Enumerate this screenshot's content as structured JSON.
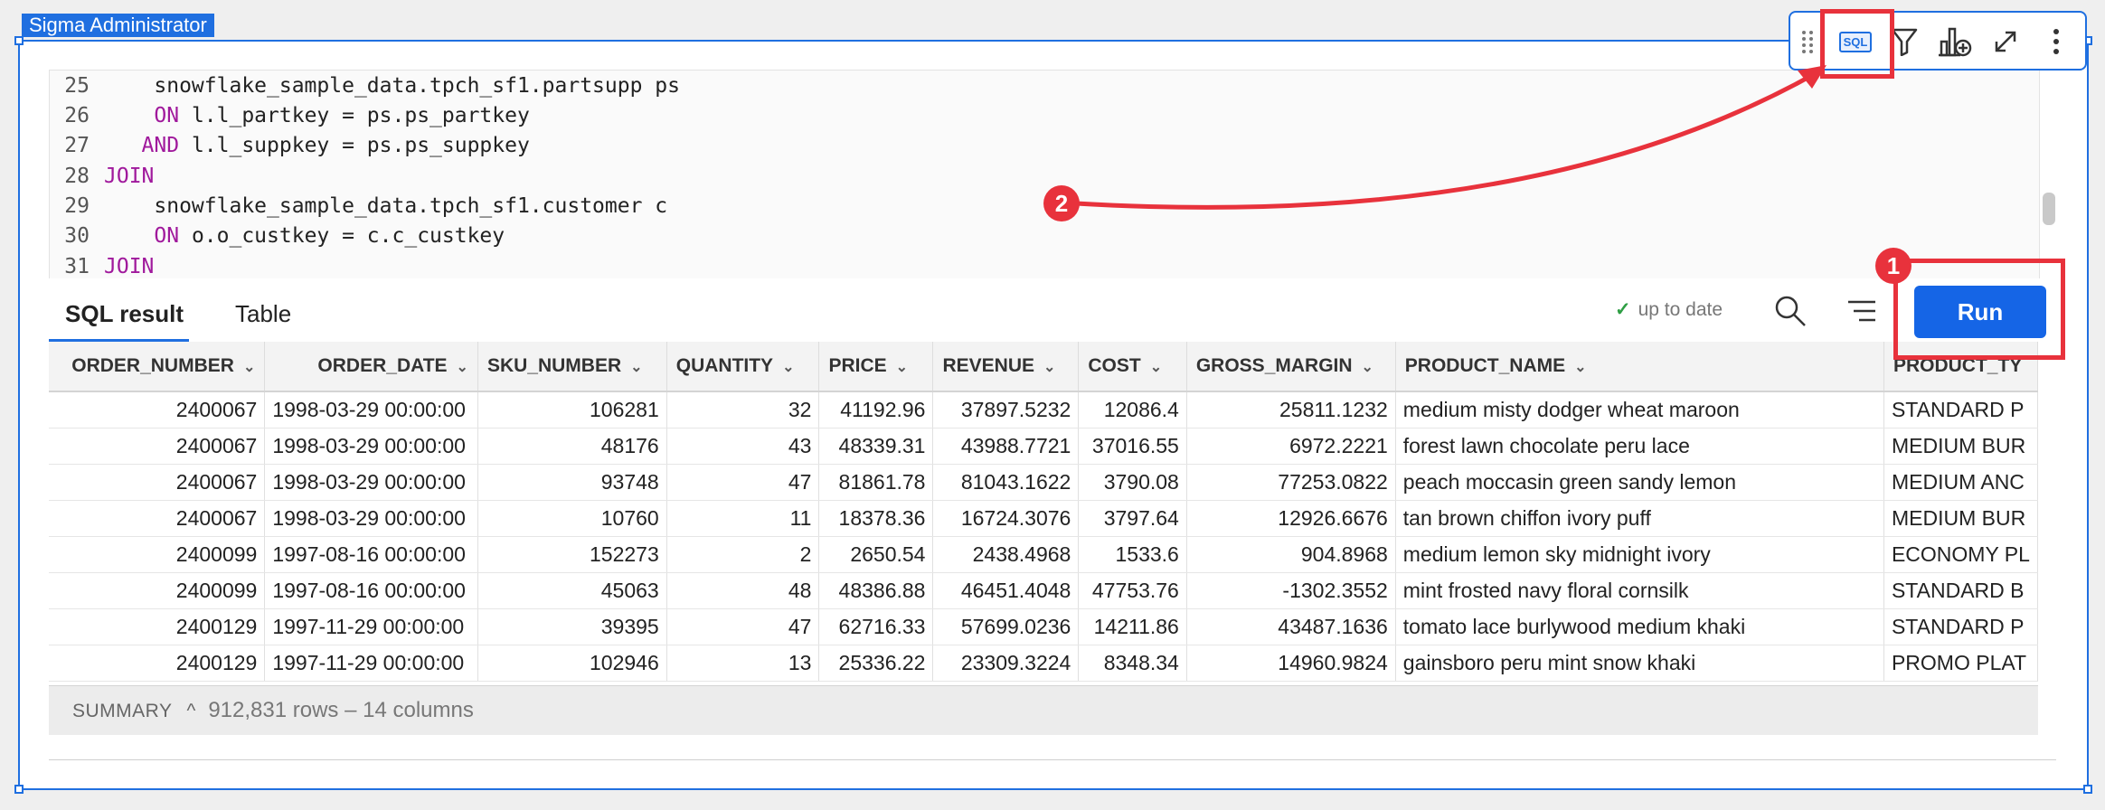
{
  "owner_tag": "Sigma Administrator",
  "code_lines": [
    {
      "num": "25",
      "indent": "    ",
      "kw": "",
      "rest": "snowflake_sample_data.tpch_sf1.partsupp ps"
    },
    {
      "num": "26",
      "indent": "    ",
      "kw": "ON",
      "rest": " l.l_partkey = ps.ps_partkey"
    },
    {
      "num": "27",
      "indent": "   ",
      "kw": "AND",
      "rest": " l.l_suppkey = ps.ps_suppkey"
    },
    {
      "num": "28",
      "indent": "",
      "kw": "JOIN",
      "rest": ""
    },
    {
      "num": "29",
      "indent": "    ",
      "kw": "",
      "rest": "snowflake_sample_data.tpch_sf1.customer c"
    },
    {
      "num": "30",
      "indent": "    ",
      "kw": "ON",
      "rest": " o.o_custkey = c.c_custkey"
    },
    {
      "num": "31",
      "indent": "",
      "kw": "JOIN",
      "rest": ""
    }
  ],
  "toolbar": {
    "sql_label": "SQL"
  },
  "callouts": {
    "one": "1",
    "two": "2"
  },
  "tabs": {
    "sql_result": "SQL result",
    "table": "Table"
  },
  "status": {
    "text": "up to date"
  },
  "run_label": "Run",
  "columns": [
    "ORDER_NUMBER",
    "ORDER_DATE",
    "SKU_NUMBER",
    "QUANTITY",
    "PRICE",
    "REVENUE",
    "COST",
    "GROSS_MARGIN",
    "PRODUCT_NAME",
    "PRODUCT_TY"
  ],
  "rows": [
    [
      "2400067",
      "1998-03-29 00:00:00",
      "106281",
      "32",
      "41192.96",
      "37897.5232",
      "12086.4",
      "25811.1232",
      "medium misty dodger wheat maroon",
      "STANDARD P"
    ],
    [
      "2400067",
      "1998-03-29 00:00:00",
      "48176",
      "43",
      "48339.31",
      "43988.7721",
      "37016.55",
      "6972.2221",
      "forest lawn chocolate peru lace",
      "MEDIUM BUR"
    ],
    [
      "2400067",
      "1998-03-29 00:00:00",
      "93748",
      "47",
      "81861.78",
      "81043.1622",
      "3790.08",
      "77253.0822",
      "peach moccasin green sandy lemon",
      "MEDIUM ANC"
    ],
    [
      "2400067",
      "1998-03-29 00:00:00",
      "10760",
      "11",
      "18378.36",
      "16724.3076",
      "3797.64",
      "12926.6676",
      "tan brown chiffon ivory puff",
      "MEDIUM BUR"
    ],
    [
      "2400099",
      "1997-08-16 00:00:00",
      "152273",
      "2",
      "2650.54",
      "2438.4968",
      "1533.6",
      "904.8968",
      "medium lemon sky midnight ivory",
      "ECONOMY PL"
    ],
    [
      "2400099",
      "1997-08-16 00:00:00",
      "45063",
      "48",
      "48386.88",
      "46451.4048",
      "47753.76",
      "-1302.3552",
      "mint frosted navy floral cornsilk",
      "STANDARD B"
    ],
    [
      "2400129",
      "1997-11-29 00:00:00",
      "39395",
      "47",
      "62716.33",
      "57699.0236",
      "14211.86",
      "43487.1636",
      "tomato lace burlywood medium khaki",
      "STANDARD P"
    ],
    [
      "2400129",
      "1997-11-29 00:00:00",
      "102946",
      "13",
      "25336.22",
      "23309.3224",
      "8348.34",
      "14960.9824",
      "gainsboro peru mint snow khaki",
      "PROMO PLAT"
    ]
  ],
  "summary": {
    "label": "SUMMARY",
    "count": "912,831 rows – 14 columns"
  },
  "colors": {
    "accent": "#1f6fe0",
    "run_button": "#1565e6",
    "annotation": "#e8323c",
    "keyword": "#a0199c"
  }
}
